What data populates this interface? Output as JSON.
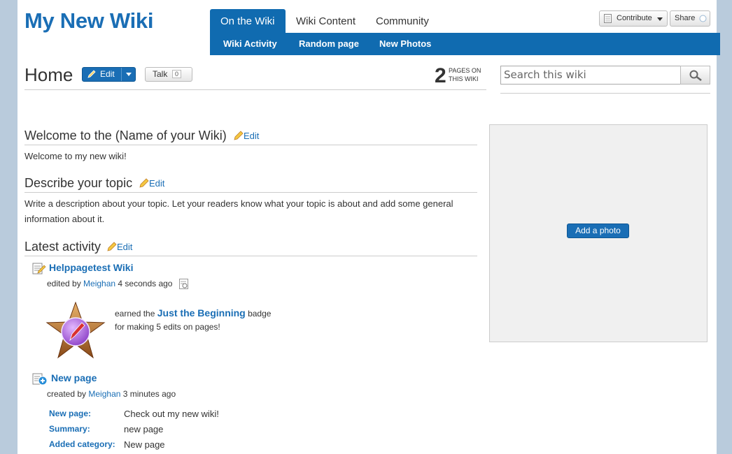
{
  "site": {
    "title": "My New Wiki"
  },
  "nav": {
    "tabs": [
      "On the Wiki",
      "Wiki Content",
      "Community"
    ],
    "subnav": [
      "Wiki Activity",
      "Random page",
      "New Photos"
    ],
    "contribute_label": "Contribute",
    "share_label": "Share"
  },
  "page": {
    "title": "Home",
    "edit_label": "Edit",
    "talk_label": "Talk",
    "talk_count": "0",
    "pages_count": "2",
    "pages_label_line1": "PAGES ON",
    "pages_label_line2": "THIS WIKI"
  },
  "search": {
    "placeholder": "Search this wiki"
  },
  "sections": [
    {
      "heading": "Welcome to the (Name of your Wiki)",
      "edit": "Edit",
      "text": "Welcome to my new wiki!"
    },
    {
      "heading": "Describe your topic",
      "edit": "Edit",
      "text": "Write a description about your topic. Let your readers know what your topic is about and add some general information about it."
    },
    {
      "heading": "Latest activity",
      "edit": "Edit"
    }
  ],
  "activity": {
    "item1": {
      "title": "Helppagetest Wiki",
      "prefix": "edited by",
      "user": "Meighan",
      "time": "4 seconds ago"
    },
    "badge": {
      "prefix": "earned the",
      "name": "Just the Beginning",
      "suffix": "badge",
      "description": "for making 5 edits on pages!"
    },
    "item2": {
      "title": "New page",
      "prefix": "created by",
      "user": "Meighan",
      "time": "3 minutes ago",
      "details": [
        {
          "label": "New page:",
          "value": "Check out my new wiki!"
        },
        {
          "label": "Summary:",
          "value": "new page"
        },
        {
          "label": "Added category:",
          "value": "New page"
        }
      ]
    }
  },
  "sidebar": {
    "add_photo_label": "Add a photo"
  },
  "colors": {
    "accent": "#1a6eb5",
    "nav": "#106bb0",
    "background": "#b9cbdc"
  }
}
